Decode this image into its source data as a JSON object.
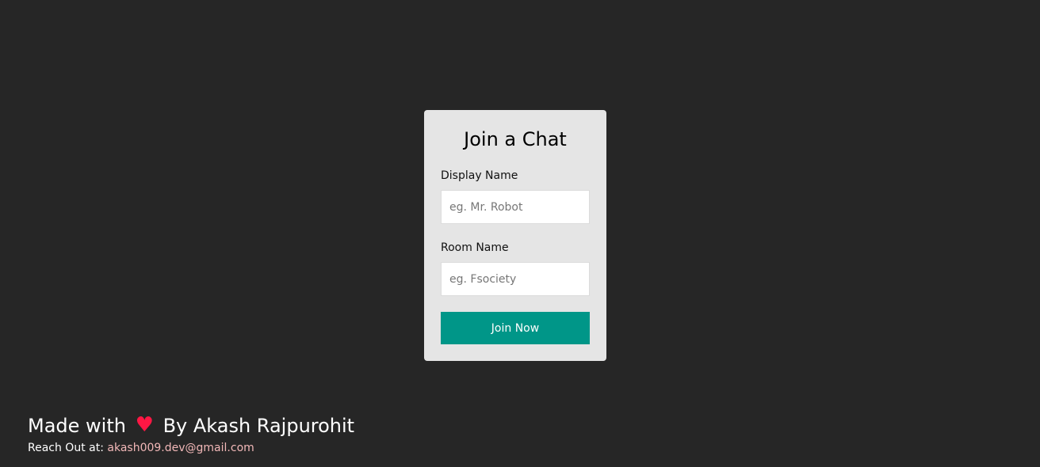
{
  "join_card": {
    "title": "Join a Chat",
    "display_name": {
      "label": "Display Name",
      "value": "",
      "placeholder": "eg. Mr. Robot"
    },
    "room_name": {
      "label": "Room Name",
      "value": "",
      "placeholder": "eg. Fsociety"
    },
    "join_button_label": "Join Now"
  },
  "footer": {
    "made_with": "Made with",
    "heart_icon": "♥",
    "by_author": "By Akash Rajpurohit",
    "reach_out_label": "Reach Out at:",
    "email": "akash009.dev@gmail.com"
  },
  "colors": {
    "background": "#262626",
    "card": "#e5e5e5",
    "button": "#009688",
    "heart": "#ff1744",
    "email_link": "#f2b8b8"
  }
}
